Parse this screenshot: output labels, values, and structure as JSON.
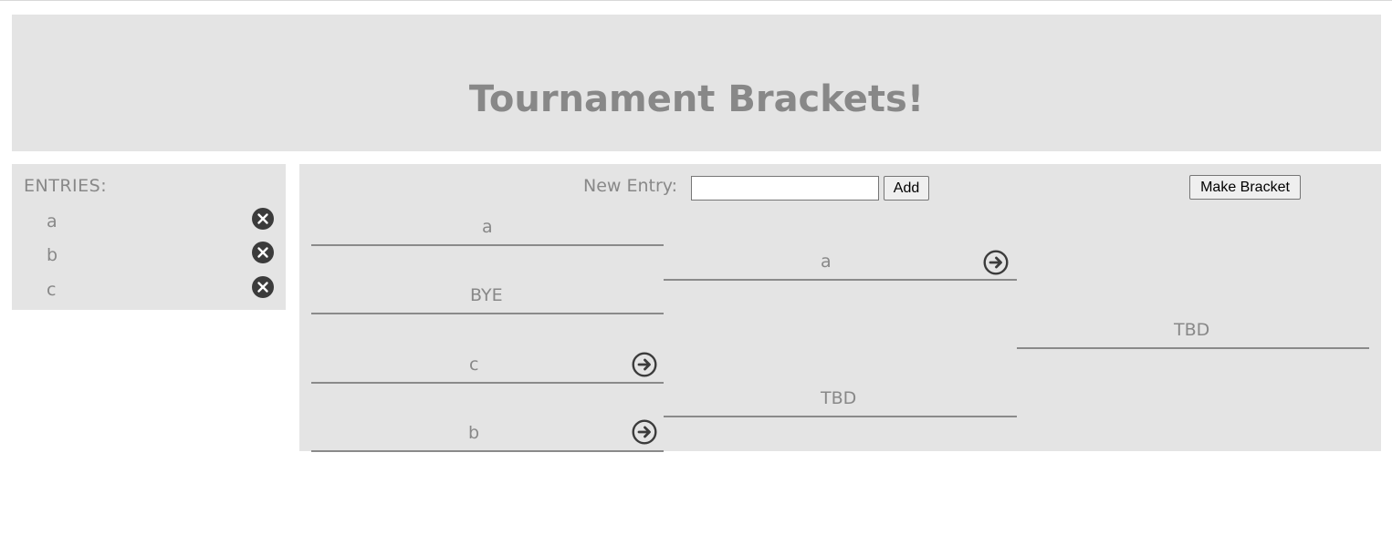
{
  "header": {
    "title": "Tournament Brackets!"
  },
  "entries": {
    "heading": "ENTRIES:",
    "items": [
      {
        "name": "a",
        "remove_icon": "close-circle-icon"
      },
      {
        "name": "b",
        "remove_icon": "close-circle-icon"
      },
      {
        "name": "c",
        "remove_icon": "close-circle-icon"
      }
    ]
  },
  "controls": {
    "new_entry_label": "New Entry:",
    "new_entry_value": "",
    "add_label": "Add",
    "make_bracket_label": "Make Bracket"
  },
  "bracket": {
    "round1": [
      {
        "name": "a",
        "advance_icon": ""
      },
      {
        "name": "BYE",
        "advance_icon": ""
      },
      {
        "name": "c",
        "advance_icon": "arrow-right-circle-icon"
      },
      {
        "name": "b",
        "advance_icon": "arrow-right-circle-icon"
      }
    ],
    "round2": [
      {
        "name": "a",
        "advance_icon": "arrow-right-circle-icon"
      },
      {
        "name": "TBD",
        "advance_icon": ""
      }
    ],
    "round3": [
      {
        "name": "TBD",
        "advance_icon": ""
      }
    ]
  },
  "colors": {
    "panel_bg": "#e4e4e4",
    "text_gray": "#888888",
    "icon_dark": "#3b3b3b",
    "line_gray": "#8a8a8a"
  }
}
